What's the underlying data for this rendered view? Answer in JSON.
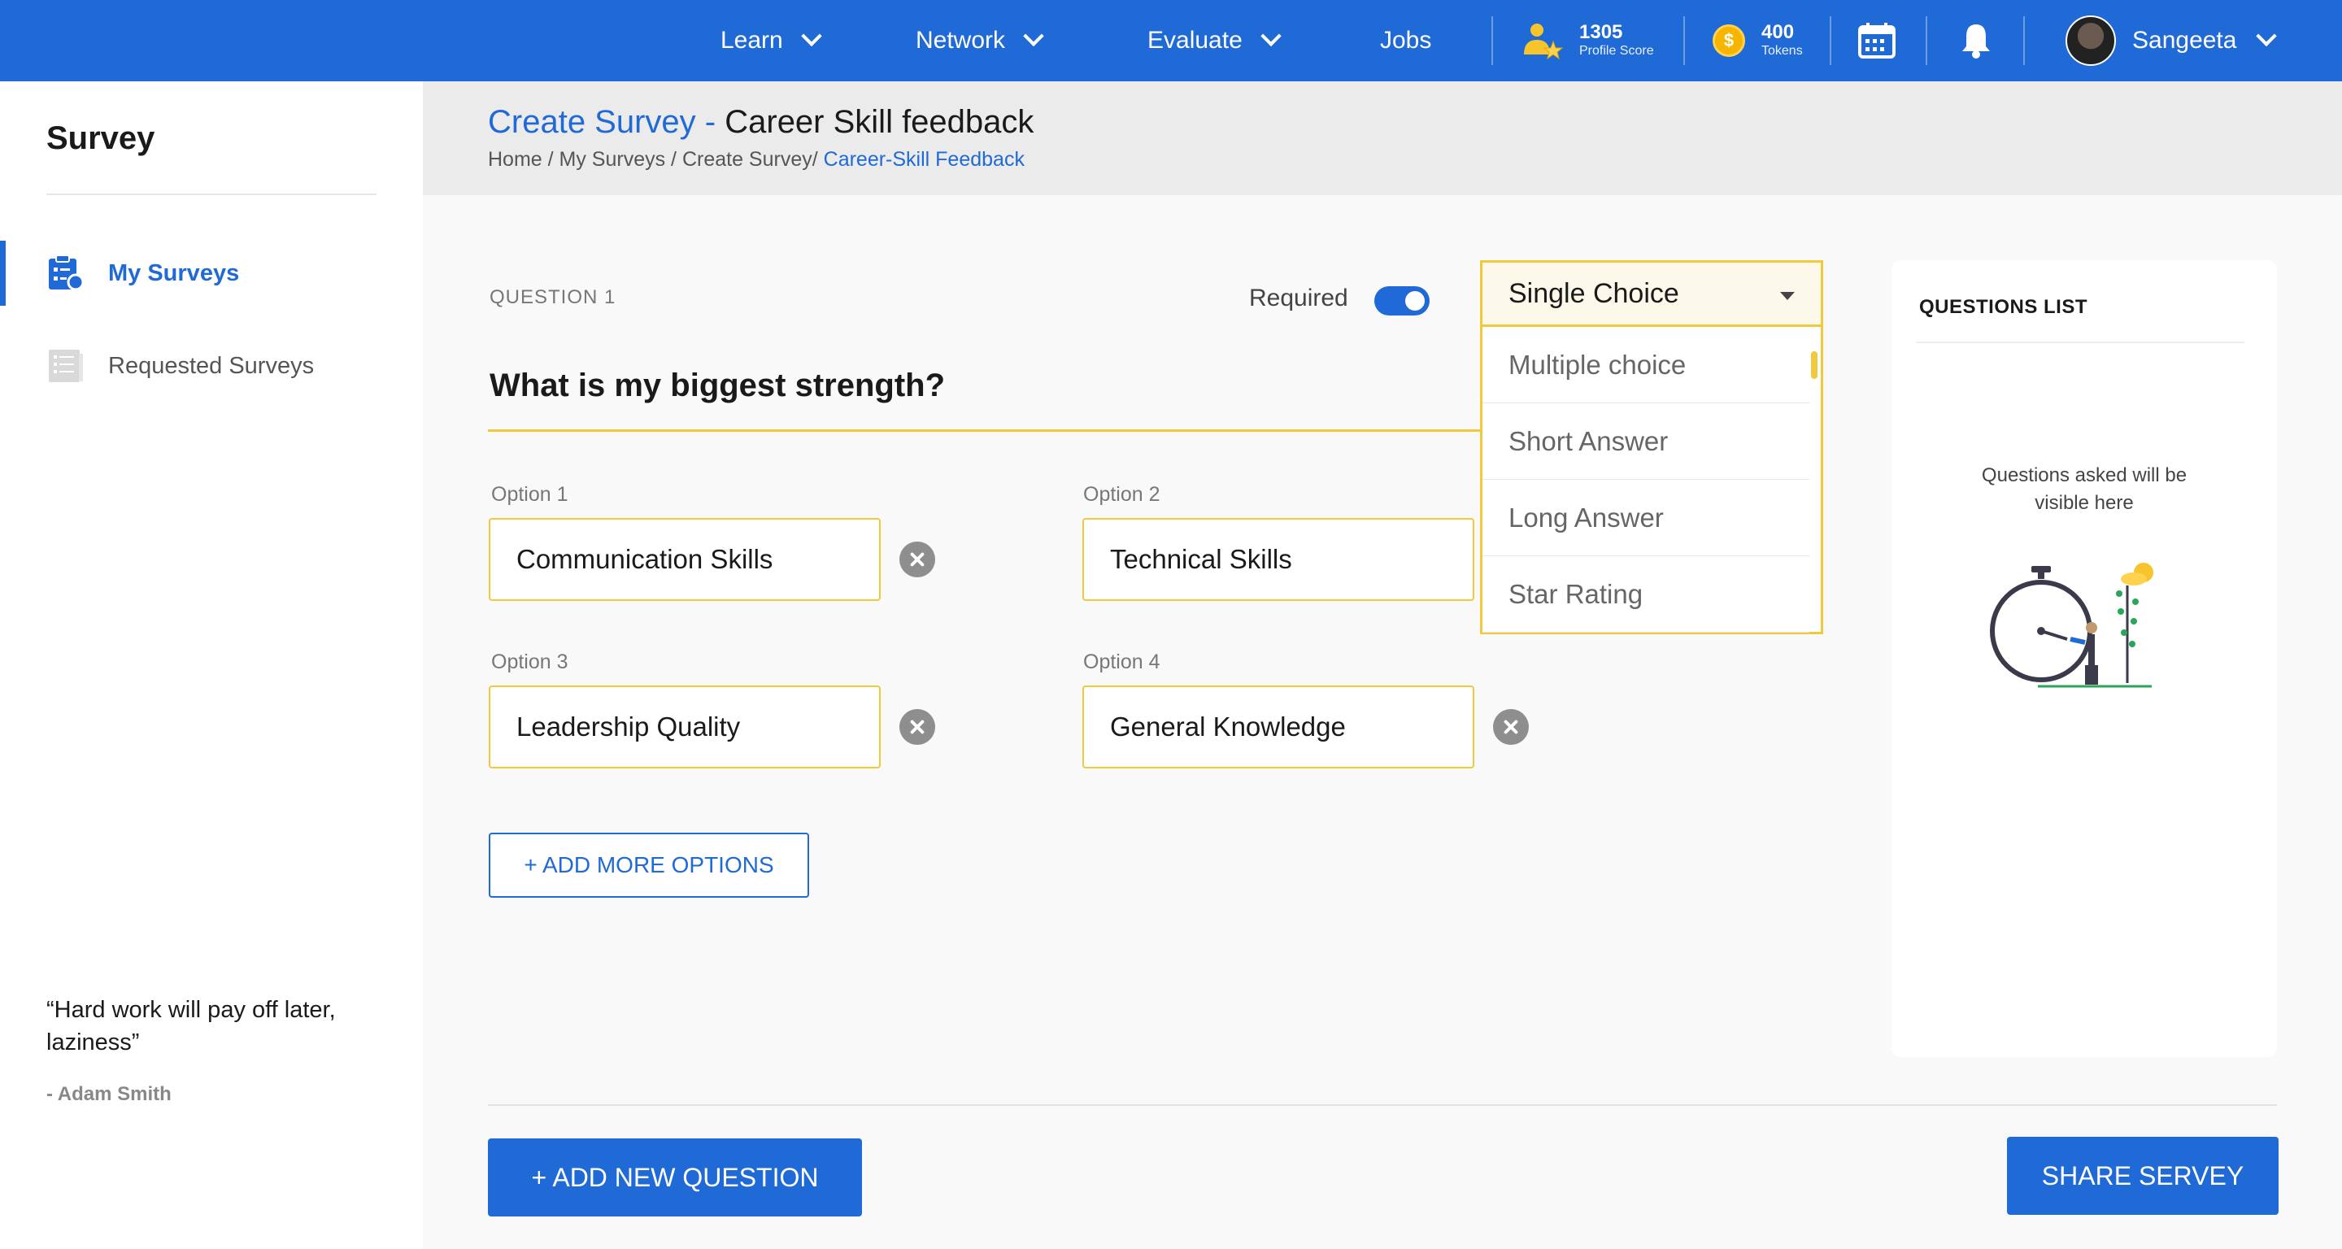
{
  "topbar": {
    "nav": [
      {
        "label": "Learn",
        "has_dropdown": true
      },
      {
        "label": "Network",
        "has_dropdown": true
      },
      {
        "label": "Evaluate",
        "has_dropdown": true
      },
      {
        "label": "Jobs",
        "has_dropdown": false
      }
    ],
    "profile_score": {
      "value": "1305",
      "label": "Profile Score"
    },
    "tokens": {
      "value": "400",
      "label": "Tokens",
      "coin_symbol": "$"
    },
    "user": {
      "name": "Sangeeta"
    },
    "icons": [
      "trophy-user-icon",
      "coin-icon",
      "calendar-icon",
      "bell-icon",
      "chevron-down-icon"
    ]
  },
  "sidebar": {
    "title": "Survey",
    "items": [
      {
        "label": "My Surveys",
        "active": true,
        "icon": "survey-clipboard-icon"
      },
      {
        "label": "Requested Surveys",
        "active": false,
        "icon": "list-document-icon"
      }
    ],
    "quote": "“Hard work will pay off later, laziness”",
    "author": "- Adam Smith"
  },
  "header": {
    "title_prefix": "Create Survey -",
    "title_main": "Career Skill feedback",
    "breadcrumb_path": "Home / My Surveys / Create Survey/",
    "breadcrumb_current": "Career-Skill Feedback"
  },
  "question": {
    "number_label": "QUESTION 1",
    "required_label": "Required",
    "required": true,
    "text": "What is my biggest strength?",
    "type_selected": "Single Choice",
    "type_options": [
      "Multiple choice",
      "Short Answer",
      "Long Answer",
      "Star Rating"
    ],
    "options": [
      {
        "label": "Option 1",
        "value": "Communication Skills"
      },
      {
        "label": "Option 2",
        "value": "Technical Skills"
      },
      {
        "label": "Option 3",
        "value": "Leadership Quality"
      },
      {
        "label": "Option 4",
        "value": "General Knowledge"
      }
    ],
    "add_options_label": "+ ADD MORE OPTIONS"
  },
  "questions_list": {
    "title": "QUESTIONS LIST",
    "empty_text": "Questions asked will be visible here"
  },
  "footer": {
    "add_question_label": "+ ADD NEW QUESTION",
    "share_label": "SHARE SERVEY"
  },
  "colors": {
    "primary": "#1f6ad6",
    "accent_yellow": "#f0c93d",
    "coin": "#f7b500"
  }
}
